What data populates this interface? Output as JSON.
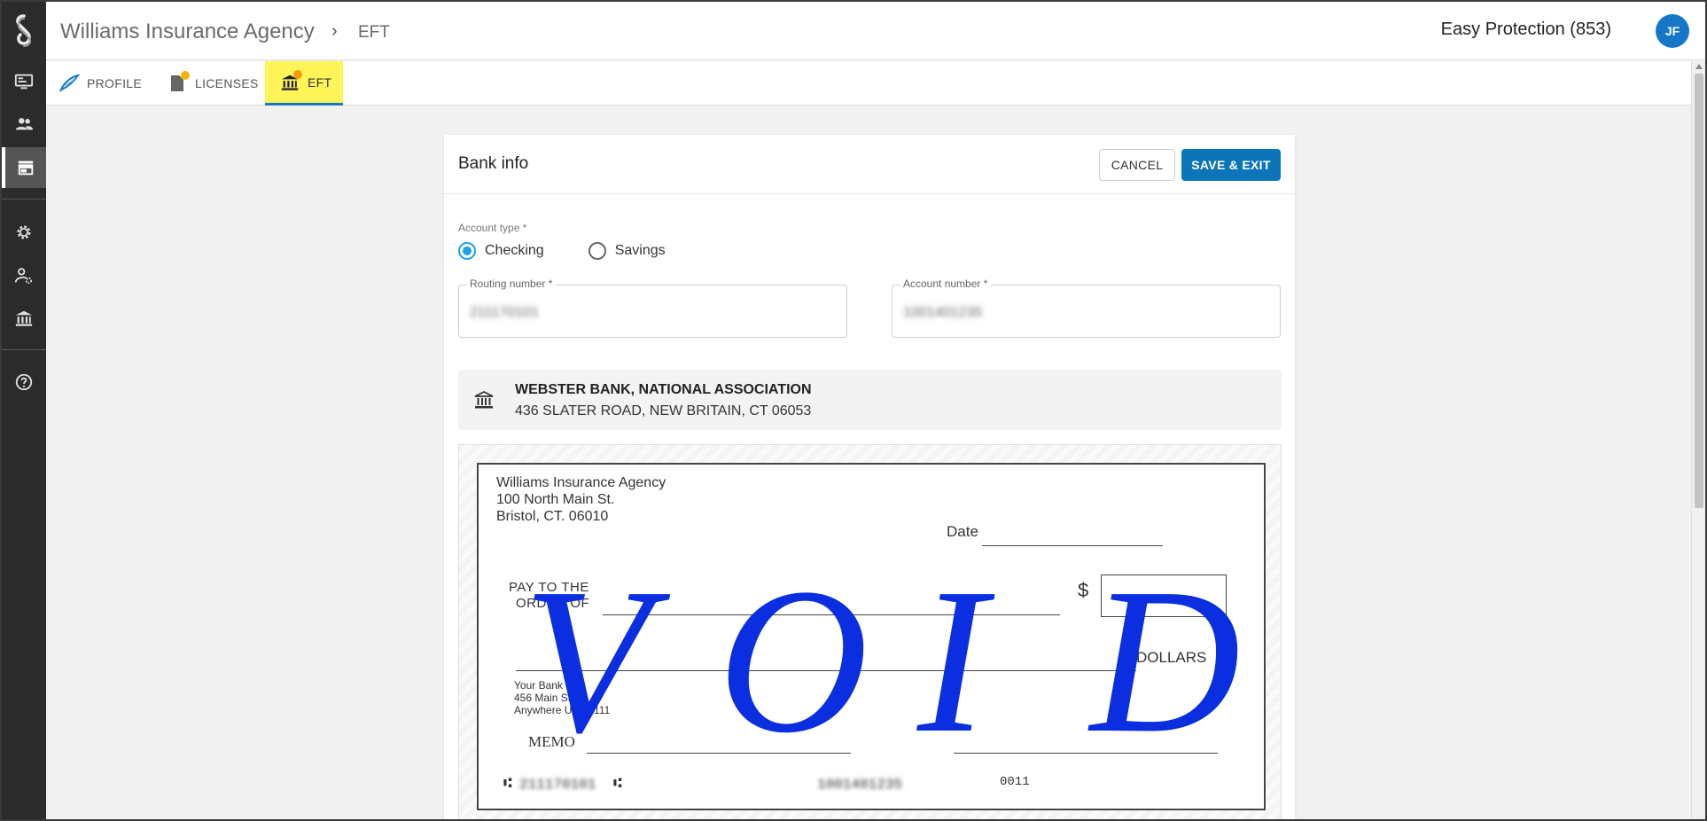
{
  "sidebar": {
    "items": [
      {
        "icon": "desktop-icon"
      },
      {
        "icon": "people-icon"
      },
      {
        "icon": "store-icon",
        "active": true
      },
      {
        "icon": "gear-icon"
      },
      {
        "icon": "user-settings-icon"
      },
      {
        "icon": "bank-icon"
      },
      {
        "icon": "help-icon"
      }
    ]
  },
  "header": {
    "breadcrumb_main": "Williams Insurance Agency",
    "breadcrumb_sep": "›",
    "breadcrumb_current": "EFT",
    "org": "Easy Protection (853)",
    "avatar_initials": "JF"
  },
  "tabs": [
    {
      "label": "PROFILE",
      "icon": "feather-icon"
    },
    {
      "label": "LICENSES",
      "icon": "document-icon",
      "badge": true
    },
    {
      "label": "EFT",
      "icon": "bank-icon",
      "badge": true,
      "active": true
    }
  ],
  "card": {
    "title": "Bank info",
    "cancel_label": "CANCEL",
    "save_label": "SAVE & EXIT",
    "account_type_label": "Account type *",
    "options": [
      "Checking",
      "Savings"
    ],
    "selected_option": "Checking",
    "routing_label": "Routing number *",
    "routing_value": "211170101",
    "account_label": "Account number *",
    "account_value": "1001401235",
    "bank_name": "WEBSTER BANK, NATIONAL ASSOCIATION",
    "bank_address": "436 SLATER ROAD, NEW BRITAIN, CT 06053"
  },
  "check": {
    "payer_name": "Williams Insurance Agency",
    "payer_street": "100 North Main St.",
    "payer_city": "Bristol, CT. 06010",
    "date_label": "Date",
    "pay_to_line1": "PAY TO THE",
    "pay_to_line2": "ORDER OF",
    "dollar_sign": "$",
    "dollars_label": "DOLLARS",
    "bank_line1": "Your Bank",
    "bank_line2": "456 Main St",
    "bank_line3": "Anywhere US 10111",
    "memo_label": "MEMO",
    "micr_routing": "211170101",
    "micr_account": "1001401235",
    "micr_check_no": "0011",
    "void_text": "VOID",
    "void_color": "#0a2ee0"
  }
}
